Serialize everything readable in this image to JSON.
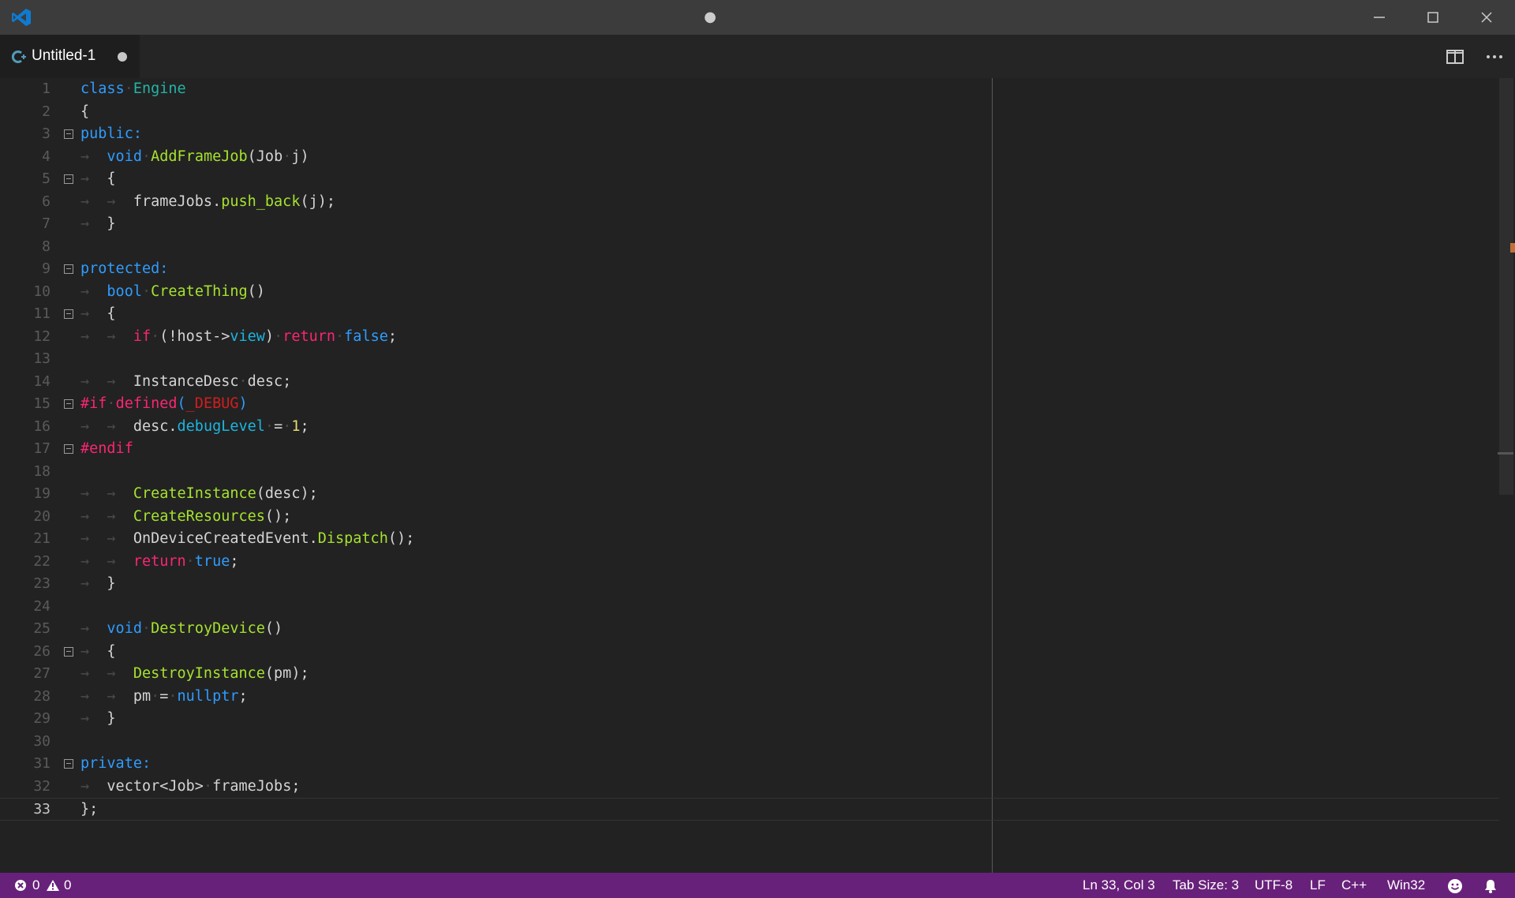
{
  "window": {
    "title_indicator": "●"
  },
  "tab": {
    "label": "Untitled-1",
    "dirty": true
  },
  "editor": {
    "language": "C++",
    "lines": [
      {
        "n": "1",
        "fold": false,
        "tokens": [
          [
            "kw",
            "class"
          ],
          [
            "ws",
            "·"
          ],
          [
            "ty",
            "Engine"
          ]
        ]
      },
      {
        "n": "2",
        "fold": false,
        "tokens": [
          [
            "tx",
            "{"
          ]
        ]
      },
      {
        "n": "3",
        "fold": true,
        "tokens": [
          [
            "kw",
            "public:"
          ]
        ]
      },
      {
        "n": "4",
        "fold": false,
        "tokens": [
          [
            "ws",
            "→  "
          ],
          [
            "kw",
            "void"
          ],
          [
            "ws",
            "·"
          ],
          [
            "fn",
            "AddFrameJob"
          ],
          [
            "tx",
            "(Job"
          ],
          [
            "ws",
            "·"
          ],
          [
            "tx",
            "j)"
          ]
        ]
      },
      {
        "n": "5",
        "fold": true,
        "tokens": [
          [
            "ws",
            "→  "
          ],
          [
            "tx",
            "{"
          ]
        ]
      },
      {
        "n": "6",
        "fold": false,
        "tokens": [
          [
            "ws",
            "→  →  "
          ],
          [
            "tx",
            "frameJobs."
          ],
          [
            "fn",
            "push_back"
          ],
          [
            "tx",
            "(j);"
          ]
        ]
      },
      {
        "n": "7",
        "fold": false,
        "tokens": [
          [
            "ws",
            "→  "
          ],
          [
            "tx",
            "}"
          ]
        ]
      },
      {
        "n": "8",
        "fold": false,
        "tokens": []
      },
      {
        "n": "9",
        "fold": true,
        "tokens": [
          [
            "kw",
            "protected:"
          ]
        ]
      },
      {
        "n": "10",
        "fold": false,
        "tokens": [
          [
            "ws",
            "→  "
          ],
          [
            "kw",
            "bool"
          ],
          [
            "ws",
            "·"
          ],
          [
            "fn",
            "CreateThing"
          ],
          [
            "tx",
            "()"
          ]
        ]
      },
      {
        "n": "11",
        "fold": true,
        "tokens": [
          [
            "ws",
            "→  "
          ],
          [
            "tx",
            "{"
          ]
        ]
      },
      {
        "n": "12",
        "fold": false,
        "tokens": [
          [
            "ws",
            "→  →  "
          ],
          [
            "ctl",
            "if"
          ],
          [
            "ws",
            "·"
          ],
          [
            "tx",
            "(!host->"
          ],
          [
            "mem",
            "view"
          ],
          [
            "tx",
            ")"
          ],
          [
            "ws",
            "·"
          ],
          [
            "ctl",
            "return"
          ],
          [
            "ws",
            "·"
          ],
          [
            "kw",
            "false"
          ],
          [
            "tx",
            ";"
          ]
        ]
      },
      {
        "n": "13",
        "fold": false,
        "tokens": []
      },
      {
        "n": "14",
        "fold": false,
        "tokens": [
          [
            "ws",
            "→  →  "
          ],
          [
            "tx",
            "InstanceDesc"
          ],
          [
            "ws",
            "·"
          ],
          [
            "tx",
            "desc;"
          ]
        ]
      },
      {
        "n": "15",
        "fold": true,
        "tokens": [
          [
            "ctl",
            "#if"
          ],
          [
            "ws",
            "·"
          ],
          [
            "ctl",
            "defined"
          ],
          [
            "kw",
            "("
          ],
          [
            "mac",
            "_DEBUG"
          ],
          [
            "kw",
            ")"
          ]
        ]
      },
      {
        "n": "16",
        "fold": false,
        "tokens": [
          [
            "ws",
            "→  →  "
          ],
          [
            "tx",
            "desc."
          ],
          [
            "mem",
            "debugLevel"
          ],
          [
            "ws",
            "·"
          ],
          [
            "tx",
            "="
          ],
          [
            "ws",
            "·"
          ],
          [
            "num",
            "1"
          ],
          [
            "tx",
            ";"
          ]
        ]
      },
      {
        "n": "17",
        "fold": true,
        "tokens": [
          [
            "ctl",
            "#endif"
          ]
        ]
      },
      {
        "n": "18",
        "fold": false,
        "tokens": []
      },
      {
        "n": "19",
        "fold": false,
        "tokens": [
          [
            "ws",
            "→  →  "
          ],
          [
            "fn",
            "CreateInstance"
          ],
          [
            "tx",
            "(desc);"
          ]
        ]
      },
      {
        "n": "20",
        "fold": false,
        "tokens": [
          [
            "ws",
            "→  →  "
          ],
          [
            "fn",
            "CreateResources"
          ],
          [
            "tx",
            "();"
          ]
        ]
      },
      {
        "n": "21",
        "fold": false,
        "tokens": [
          [
            "ws",
            "→  →  "
          ],
          [
            "tx",
            "OnDeviceCreatedEvent."
          ],
          [
            "fn",
            "Dispatch"
          ],
          [
            "tx",
            "();"
          ]
        ]
      },
      {
        "n": "22",
        "fold": false,
        "tokens": [
          [
            "ws",
            "→  →  "
          ],
          [
            "ctl",
            "return"
          ],
          [
            "ws",
            "·"
          ],
          [
            "kw",
            "true"
          ],
          [
            "tx",
            ";"
          ]
        ]
      },
      {
        "n": "23",
        "fold": false,
        "tokens": [
          [
            "ws",
            "→  "
          ],
          [
            "tx",
            "}"
          ]
        ]
      },
      {
        "n": "24",
        "fold": false,
        "tokens": []
      },
      {
        "n": "25",
        "fold": false,
        "tokens": [
          [
            "ws",
            "→  "
          ],
          [
            "kw",
            "void"
          ],
          [
            "ws",
            "·"
          ],
          [
            "fn",
            "DestroyDevice"
          ],
          [
            "tx",
            "()"
          ]
        ]
      },
      {
        "n": "26",
        "fold": true,
        "tokens": [
          [
            "ws",
            "→  "
          ],
          [
            "tx",
            "{"
          ]
        ]
      },
      {
        "n": "27",
        "fold": false,
        "tokens": [
          [
            "ws",
            "→  →  "
          ],
          [
            "fn",
            "DestroyInstance"
          ],
          [
            "tx",
            "(pm);"
          ]
        ]
      },
      {
        "n": "28",
        "fold": false,
        "tokens": [
          [
            "ws",
            "→  →  "
          ],
          [
            "tx",
            "pm"
          ],
          [
            "ws",
            "·"
          ],
          [
            "tx",
            "="
          ],
          [
            "ws",
            "·"
          ],
          [
            "kw",
            "nullptr"
          ],
          [
            "tx",
            ";"
          ]
        ]
      },
      {
        "n": "29",
        "fold": false,
        "tokens": [
          [
            "ws",
            "→  "
          ],
          [
            "tx",
            "}"
          ]
        ]
      },
      {
        "n": "30",
        "fold": false,
        "tokens": []
      },
      {
        "n": "31",
        "fold": true,
        "tokens": [
          [
            "kw",
            "private:"
          ]
        ]
      },
      {
        "n": "32",
        "fold": false,
        "tokens": [
          [
            "ws",
            "→  "
          ],
          [
            "tx",
            "vector<Job>"
          ],
          [
            "ws",
            "·"
          ],
          [
            "tx",
            "frameJobs;"
          ]
        ]
      },
      {
        "n": "33",
        "fold": false,
        "current": true,
        "tokens": [
          [
            "tx",
            "};"
          ]
        ]
      }
    ]
  },
  "statusbar": {
    "errors": "0",
    "warnings": "0",
    "position": "Ln 33, Col 3",
    "tab_size": "Tab Size: 3",
    "encoding": "UTF-8",
    "eol": "LF",
    "language": "C++",
    "platform": "Win32",
    "background": "#68217a"
  },
  "colors": {
    "keyword": "#2f9cff",
    "type": "#23b4a6",
    "function": "#a6e22e",
    "control": "#f92672",
    "member": "#1cb5e0",
    "number": "#e6db74",
    "macro": "#d11e1e"
  }
}
